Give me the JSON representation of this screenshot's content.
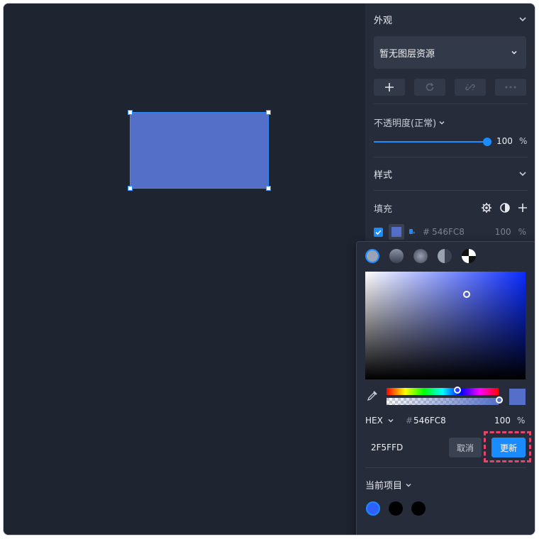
{
  "appearance": {
    "header": "外观",
    "layer_dropdown": "暂无图层资源",
    "opacity_label": "不透明度(正常)",
    "opacity_value": "100",
    "opacity_unit": "%"
  },
  "style": {
    "header": "样式",
    "fill_label": "填充",
    "fill_item": {
      "hash": "#",
      "hex": "546FC8",
      "opacity": "100",
      "unit": "%"
    }
  },
  "color_picker": {
    "fill_types": [
      "solid",
      "linear-gradient",
      "radial-gradient",
      "angular-gradient",
      "image"
    ],
    "mode": "HEX",
    "hash": "#",
    "hex": "546FC8",
    "alpha": "100",
    "alpha_unit": "%",
    "input_value": "2F5FFD",
    "cancel_label": "取消",
    "update_label": "更新",
    "recent_label": "当前项目",
    "recent_colors": [
      "#2F5FFD",
      "#000000",
      "#000000"
    ],
    "hue_fraction": 0.63,
    "alpha_fraction": 1.0
  },
  "colors": {
    "accent": "#1A8CFF",
    "shape_fill": "#546FC8",
    "highlight": "#E8456D"
  }
}
